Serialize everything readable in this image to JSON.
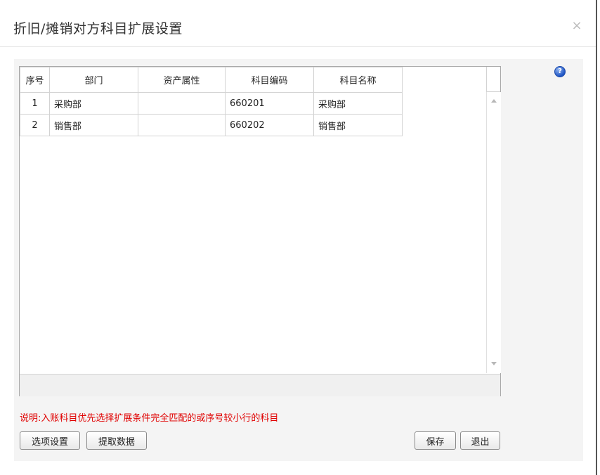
{
  "dialog": {
    "title": "折旧/摊销对方科目扩展设置",
    "close_glyph": "×",
    "help_glyph": "?"
  },
  "table": {
    "columns": [
      "序号",
      "部门",
      "资产属性",
      "科目编码",
      "科目名称"
    ],
    "rows": [
      {
        "seq": "1",
        "department": "采购部",
        "asset_attr": "",
        "account_code": "660201",
        "account_name": "采购部"
      },
      {
        "seq": "2",
        "department": "销售部",
        "asset_attr": "",
        "account_code": "660202",
        "account_name": "销售部"
      }
    ]
  },
  "note": "说明:入账科目优先选择扩展条件完全匹配的或序号较小行的科目",
  "buttons": {
    "options": "选项设置",
    "fetch": "提取数据",
    "save": "保存",
    "exit": "退出"
  },
  "colors": {
    "note": "#e00000",
    "help_icon": "#1f55c4"
  }
}
